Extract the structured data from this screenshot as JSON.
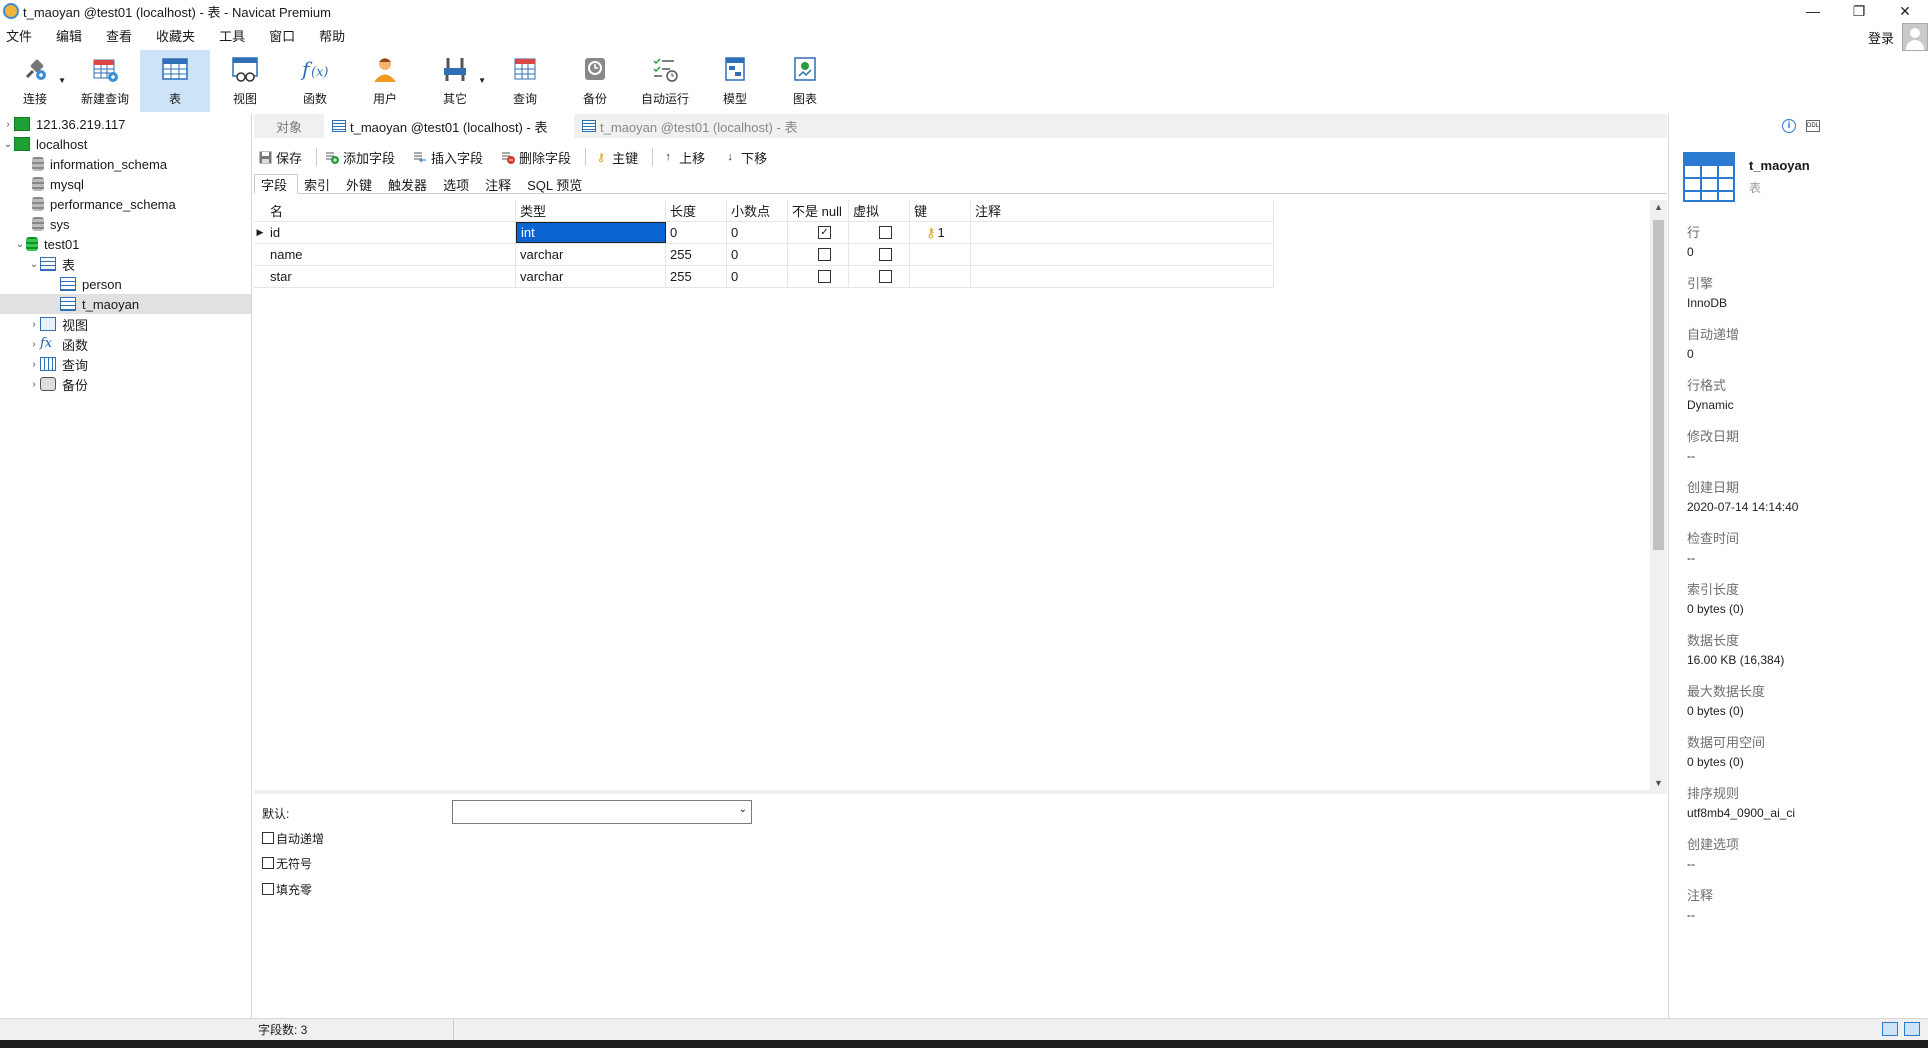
{
  "window": {
    "title": "t_maoyan @test01 (localhost) - 表 - Navicat Premium",
    "minimize": "—",
    "restore": "❐",
    "close": "✕"
  },
  "menu": [
    "文件",
    "编辑",
    "查看",
    "收藏夹",
    "工具",
    "窗口",
    "帮助"
  ],
  "login_label": "登录",
  "toolbar": [
    {
      "label": "连接",
      "icon": "plug-icon",
      "dropdown": true
    },
    {
      "label": "新建查询",
      "icon": "new-query-icon"
    },
    {
      "label": "表",
      "icon": "table-icon",
      "active": true
    },
    {
      "label": "视图",
      "icon": "view-icon"
    },
    {
      "label": "函数",
      "icon": "function-icon"
    },
    {
      "label": "用户",
      "icon": "user-icon"
    },
    {
      "label": "其它",
      "icon": "tools-icon",
      "dropdown": true
    },
    {
      "label": "查询",
      "icon": "query-icon"
    },
    {
      "label": "备份",
      "icon": "backup-icon"
    },
    {
      "label": "自动运行",
      "icon": "schedule-icon"
    },
    {
      "label": "模型",
      "icon": "model-icon"
    },
    {
      "label": "图表",
      "icon": "chart-icon"
    }
  ],
  "tree": {
    "conn1": "121.36.219.117",
    "conn2": "localhost",
    "db1": "information_schema",
    "db2": "mysql",
    "db3": "performance_schema",
    "db4": "sys",
    "db5": "test01",
    "tables_group": "表",
    "table1": "person",
    "table2": "t_maoyan",
    "views": "视图",
    "functions": "函数",
    "queries": "查询",
    "backups": "备份"
  },
  "tabs": {
    "objects": "对象",
    "active": "t_maoyan @test01 (localhost) - 表",
    "inactive": "t_maoyan @test01 (localhost) - 表"
  },
  "actions": {
    "save": "保存",
    "add_field": "添加字段",
    "insert_field": "插入字段",
    "delete_field": "删除字段",
    "primary_key": "主键",
    "move_up": "上移",
    "move_down": "下移"
  },
  "subtabs": [
    "字段",
    "索引",
    "外键",
    "触发器",
    "选项",
    "注释",
    "SQL 预览"
  ],
  "columns": [
    "名",
    "类型",
    "长度",
    "小数点",
    "不是 null",
    "虚拟",
    "键",
    "注释"
  ],
  "fields": [
    {
      "name": "id",
      "type": "int",
      "length": "0",
      "decimals": "0",
      "not_null": true,
      "virtual": false,
      "key": "1",
      "comment": ""
    },
    {
      "name": "name",
      "type": "varchar",
      "length": "255",
      "decimals": "0",
      "not_null": false,
      "virtual": false,
      "key": "",
      "comment": ""
    },
    {
      "name": "star",
      "type": "varchar",
      "length": "255",
      "decimals": "0",
      "not_null": false,
      "virtual": false,
      "key": "",
      "comment": ""
    }
  ],
  "field_props": {
    "default_label": "默认:",
    "auto_increment": "自动递增",
    "unsigned": "无符号",
    "zerofill": "填充零"
  },
  "info": {
    "name": "t_maoyan",
    "subtitle": "表",
    "items": [
      {
        "k": "行",
        "v": "0"
      },
      {
        "k": "引擎",
        "v": "InnoDB"
      },
      {
        "k": "自动递增",
        "v": "0"
      },
      {
        "k": "行格式",
        "v": "Dynamic"
      },
      {
        "k": "修改日期",
        "v": "--"
      },
      {
        "k": "创建日期",
        "v": "2020-07-14 14:14:40"
      },
      {
        "k": "检查时间",
        "v": "--"
      },
      {
        "k": "索引长度",
        "v": "0 bytes (0)"
      },
      {
        "k": "数据长度",
        "v": "16.00 KB (16,384)"
      },
      {
        "k": "最大数据长度",
        "v": "0 bytes (0)"
      },
      {
        "k": "数据可用空间",
        "v": "0 bytes (0)"
      },
      {
        "k": "排序规则",
        "v": "utf8mb4_0900_ai_ci"
      },
      {
        "k": "创建选项",
        "v": "--"
      },
      {
        "k": "注释",
        "v": "--"
      }
    ]
  },
  "status": {
    "field_count": "字段数: 3"
  }
}
